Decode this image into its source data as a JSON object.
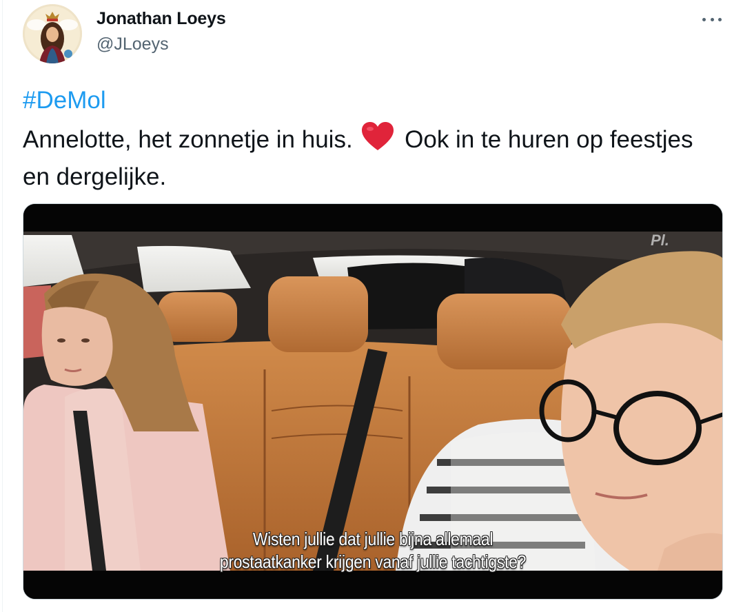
{
  "author": {
    "name": "Jonathan Loeys",
    "handle": "@JLoeys",
    "avatar_icon": "avatar"
  },
  "menu_icon": "more-horizontal-icon",
  "tweet": {
    "hashtag": "#DeMol",
    "text_before_emoji": "Annelotte, het zonnetje in huis.",
    "emoji": "red-heart-icon",
    "text_after_emoji": "Ook in te huren op feestjes en dergelijke."
  },
  "media": {
    "subtitle_line_1": "Wisten jullie dat jullie bijna allemaal",
    "subtitle_line_2": "prostaatkanker krijgen vanaf jullie tachtigste?"
  },
  "colors": {
    "link": "#1d9bf0",
    "handle": "#536471",
    "heart": "#e0243a",
    "seat_leather": "#c07a3e"
  }
}
